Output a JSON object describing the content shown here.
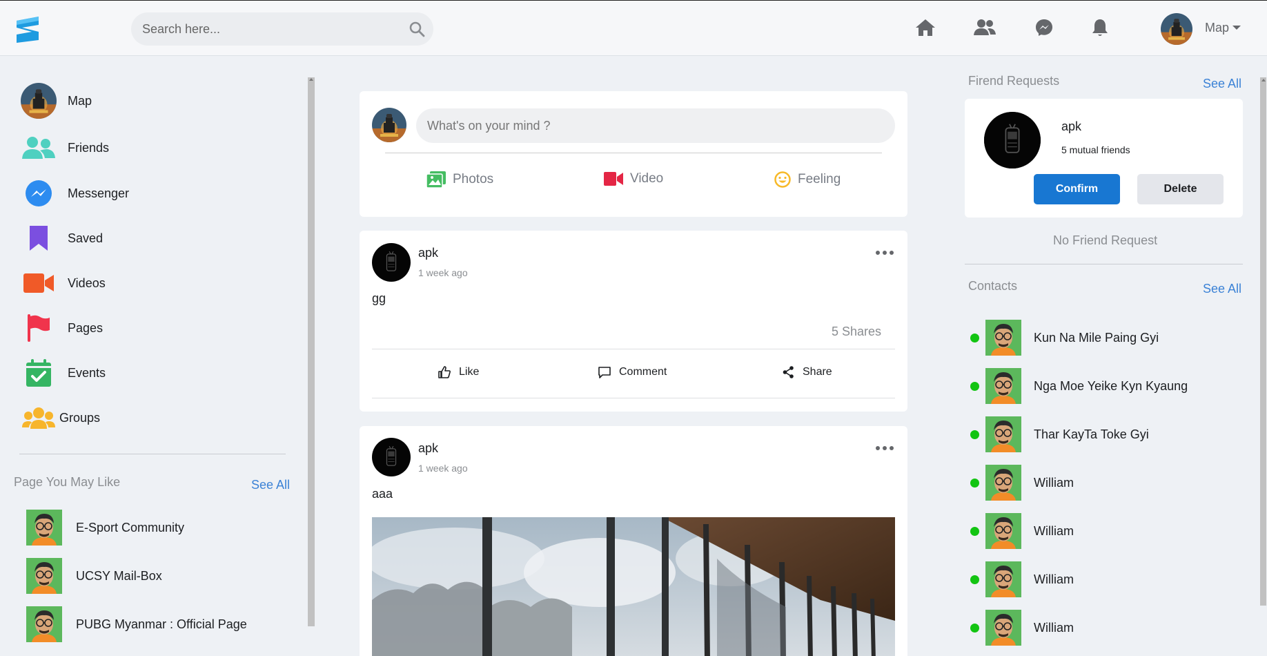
{
  "header": {
    "search_placeholder": "Search here...",
    "profile_name": "Map",
    "nav": [
      "home-icon",
      "friends-icon",
      "messenger-icon",
      "notifications-icon"
    ]
  },
  "sidebar": {
    "items": [
      {
        "label": "Map",
        "icon": "profile-avatar"
      },
      {
        "label": "Friends",
        "icon": "friends-icon",
        "color": "#4fd0c0"
      },
      {
        "label": "Messenger",
        "icon": "messenger-icon",
        "color": "#2d8cf0"
      },
      {
        "label": "Saved",
        "icon": "bookmark-icon",
        "color": "#7b4fe0"
      },
      {
        "label": "Videos",
        "icon": "video-icon",
        "color": "#f05a28"
      },
      {
        "label": "Pages",
        "icon": "flag-icon",
        "color": "#f0344c"
      },
      {
        "label": "Events",
        "icon": "calendar-check-icon",
        "color": "#35b563"
      },
      {
        "label": "Groups",
        "icon": "groups-icon",
        "color": "#f7b52c"
      }
    ],
    "pages_title": "Page You May Like",
    "pages_see_all": "See All",
    "pages": [
      {
        "label": "E-Sport Community"
      },
      {
        "label": "UCSY Mail-Box"
      },
      {
        "label": "PUBG Myanmar : Official Page"
      }
    ]
  },
  "composer": {
    "placeholder": "What's on your mind ?",
    "actions": [
      {
        "label": "Photos",
        "icon": "photos-icon",
        "color": "#45bd62"
      },
      {
        "label": "Video",
        "icon": "video-icon",
        "color": "#e42645"
      },
      {
        "label": "Feeling",
        "icon": "smile-icon",
        "color": "#f7b928"
      }
    ]
  },
  "posts": [
    {
      "author": "apk",
      "time": "1 week ago",
      "text": "gg",
      "shares": "5 Shares"
    },
    {
      "author": "apk",
      "time": "1 week ago",
      "text": "aaa"
    }
  ],
  "post_actions": {
    "like": "Like",
    "comment": "Comment",
    "share": "Share"
  },
  "right": {
    "requests_title": "Firend Requests",
    "requests_see_all": "See All",
    "request": {
      "name": "apk",
      "mutual": "5 mutual friends",
      "confirm": "Confirm",
      "delete": "Delete"
    },
    "no_request": "No Friend Request",
    "contacts_title": "Contacts",
    "contacts_see_all": "See All",
    "contacts": [
      {
        "name": "Kun Na Mile Paing Gyi"
      },
      {
        "name": "Nga Moe Yeike Kyn Kyaung"
      },
      {
        "name": "Thar KayTa Toke Gyi"
      },
      {
        "name": "William"
      },
      {
        "name": "William"
      },
      {
        "name": "William"
      },
      {
        "name": "William"
      }
    ]
  }
}
